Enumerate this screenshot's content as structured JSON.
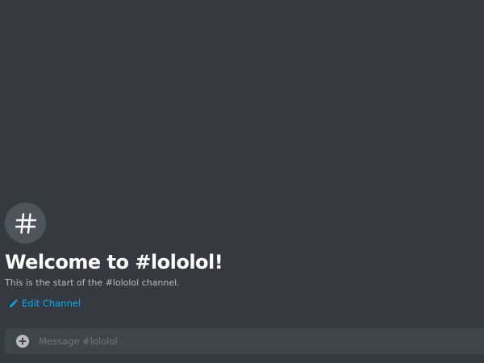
{
  "channel": {
    "icon": "hash-icon",
    "welcome_title": "Welcome to #lololol!",
    "welcome_subtitle": "This is the start of the #lololol channel.",
    "edit_label": "Edit Channel"
  },
  "composer": {
    "placeholder": "Message #lololol",
    "value": ""
  },
  "colors": {
    "background": "#36393f",
    "accent_link": "#00b0f4",
    "composer_bg": "#40444b"
  }
}
